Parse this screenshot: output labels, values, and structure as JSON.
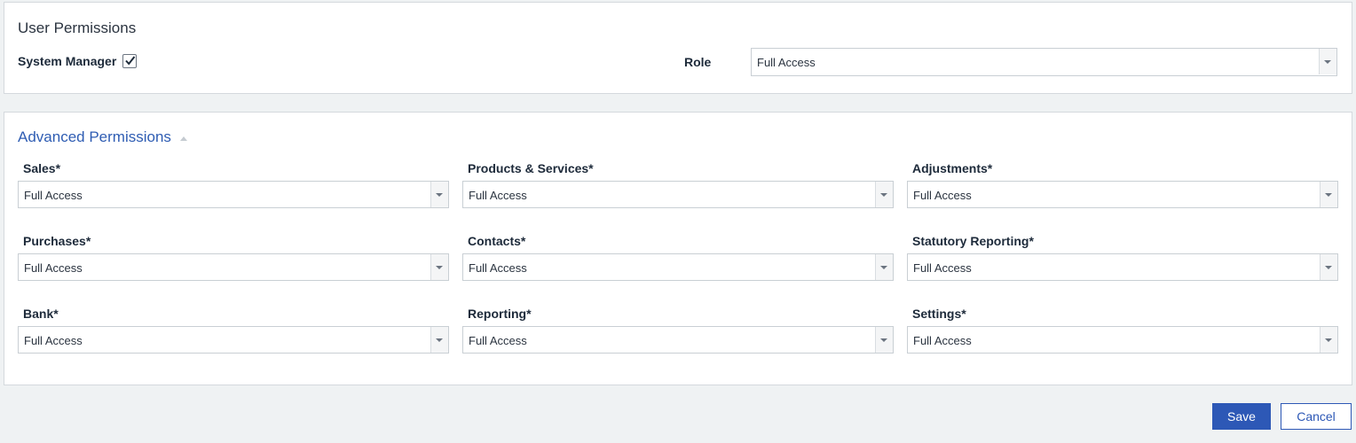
{
  "user_permissions": {
    "title": "User Permissions",
    "system_manager": {
      "label": "System Manager",
      "checked": true
    },
    "role": {
      "label": "Role",
      "value": "Full Access"
    }
  },
  "advanced_permissions": {
    "title": "Advanced Permissions",
    "fields": {
      "sales": {
        "label": "Sales*",
        "value": "Full Access"
      },
      "products_services": {
        "label": "Products & Services*",
        "value": "Full Access"
      },
      "adjustments": {
        "label": "Adjustments*",
        "value": "Full Access"
      },
      "purchases": {
        "label": "Purchases*",
        "value": "Full Access"
      },
      "contacts": {
        "label": "Contacts*",
        "value": "Full Access"
      },
      "statutory_reporting": {
        "label": "Statutory Reporting*",
        "value": "Full Access"
      },
      "bank": {
        "label": "Bank*",
        "value": "Full Access"
      },
      "reporting": {
        "label": "Reporting*",
        "value": "Full Access"
      },
      "settings": {
        "label": "Settings*",
        "value": "Full Access"
      }
    }
  },
  "actions": {
    "save_label": "Save",
    "cancel_label": "Cancel"
  },
  "colors": {
    "accent": "#2d58b6",
    "section_title": "#2f5db3",
    "page_background": "#eff2f3"
  }
}
